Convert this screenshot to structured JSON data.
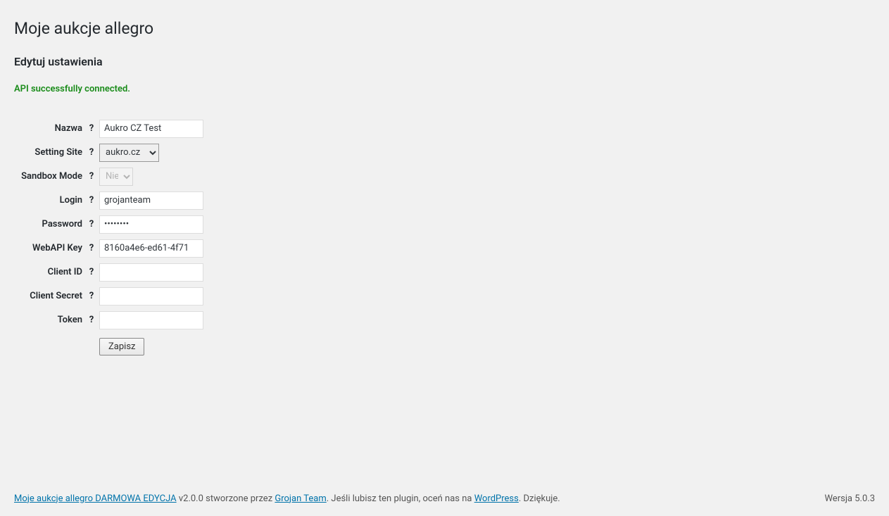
{
  "header": {
    "title": "Moje aukcje allegro",
    "subtitle": "Edytuj ustawienia"
  },
  "status": {
    "message": "API successfully connected."
  },
  "form": {
    "fields": {
      "nazwa": {
        "label": "Nazwa",
        "value": "Aukro CZ Test"
      },
      "setting_site": {
        "label": "Setting Site",
        "value": "aukro.cz"
      },
      "sandbox_mode": {
        "label": "Sandbox Mode",
        "value": "Nie"
      },
      "login": {
        "label": "Login",
        "value": "grojanteam"
      },
      "password": {
        "label": "Password",
        "value": "********"
      },
      "webapi_key": {
        "label": "WebAPI Key",
        "value": "8160a4e6-ed61-4f71"
      },
      "client_id": {
        "label": "Client ID",
        "value": ""
      },
      "client_secret": {
        "label": "Client Secret",
        "value": ""
      },
      "token": {
        "label": "Token",
        "value": ""
      }
    },
    "help_icon": "?",
    "submit_label": "Zapisz"
  },
  "footer": {
    "plugin_link_text": "Moje aukcje allegro DARMOWA EDYCJA",
    "version_text": " v2.0.0 stworzone przez ",
    "author_link_text": "Grojan Team",
    "rate_prefix": ". Jeśli lubisz ten plugin, oceń nas na ",
    "wordpress_link_text": "WordPress",
    "rate_suffix": ". Dziękuje.",
    "wp_version": "Wersja 5.0.3"
  }
}
